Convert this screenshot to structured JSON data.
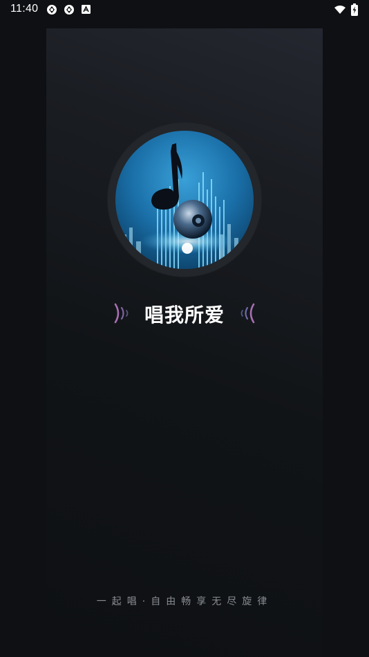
{
  "status_bar": {
    "time": "11:40",
    "left_icons": [
      "sync-icon",
      "sync-icon",
      "app-notification-icon"
    ],
    "right_icons": [
      "wifi-icon",
      "battery-charging-icon"
    ]
  },
  "splash": {
    "logo": "music-note-speaker-logo",
    "title": "唱我所爱",
    "tagline": "一起唱·自由畅享无尽旋律"
  },
  "colors": {
    "background": "#0e1013",
    "panel_top": "#252730",
    "disc_ring": "#23262b",
    "wave_left": "#a86fb4",
    "wave_right": "#7b86d6",
    "tagline": "#8a8d93"
  }
}
